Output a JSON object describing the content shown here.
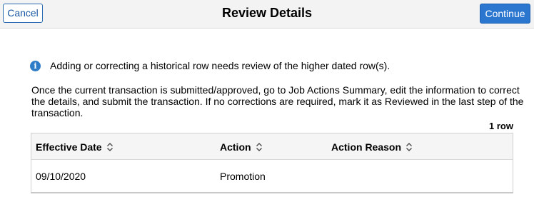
{
  "header": {
    "cancel_label": "Cancel",
    "title": "Review Details",
    "continue_label": "Continue"
  },
  "info": {
    "icon": "info-icon",
    "icon_glyph": "i",
    "message": "Adding or correcting a historical row needs review of the higher dated row(s)."
  },
  "instructions": "Once the current transaction is submitted/approved, go to Job Actions Summary, edit the information to correct the details, and submit the transaction. If no corrections are required, mark it as Reviewed in the last step of the transaction.",
  "grid": {
    "row_count": "1 row",
    "columns": [
      {
        "label": "Effective Date",
        "sort_icon": "sort-icon"
      },
      {
        "label": "Action",
        "sort_icon": "sort-icon"
      },
      {
        "label": "Action Reason",
        "sort_icon": "sort-icon"
      }
    ],
    "rows": [
      {
        "effective_date": "09/10/2020",
        "action": "Promotion",
        "action_reason": ""
      }
    ]
  },
  "colors": {
    "accent": "#2b77d0",
    "cancel_border": "#2a6ab3",
    "info_icon": "#2f7cc6",
    "header_bg": "#f3f3f3"
  }
}
